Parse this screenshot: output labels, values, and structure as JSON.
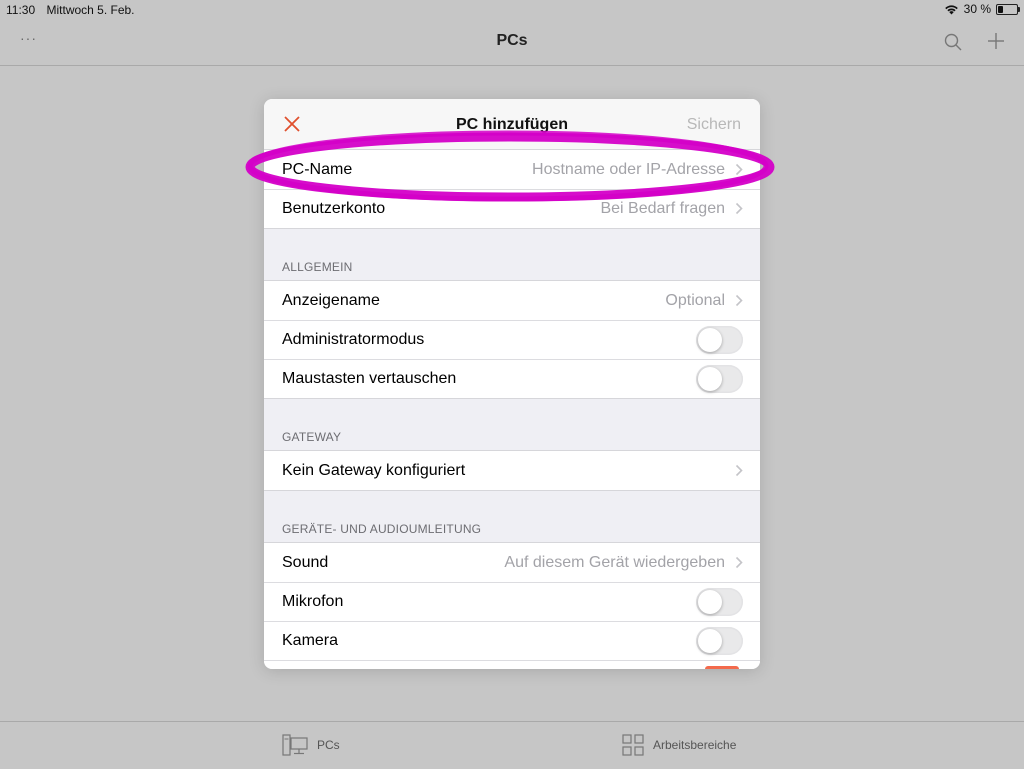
{
  "status_bar": {
    "time": "11:30",
    "date": "Mittwoch 5. Feb.",
    "battery": "30 %",
    "battery_level": 0.3
  },
  "nav": {
    "title": "PCs",
    "more": "···"
  },
  "modal": {
    "title": "PC hinzufügen",
    "save_label": "Sichern",
    "rows_top": [
      {
        "label": "PC-Name",
        "value": "Hostname oder IP-Adresse"
      },
      {
        "label": "Benutzerkonto",
        "value": "Bei Bedarf fragen"
      }
    ],
    "sections": {
      "general": {
        "header": "ALLGEMEIN",
        "display_name": {
          "label": "Anzeigename",
          "value": "Optional"
        },
        "admin_mode": {
          "label": "Administratormodus",
          "on": false
        },
        "swap_mouse": {
          "label": "Maustasten vertauschen",
          "on": false
        }
      },
      "gateway": {
        "header": "GATEWAY",
        "row": {
          "label": "Kein Gateway konfiguriert"
        }
      },
      "redirection": {
        "header": "GERÄTE- UND AUDIOUMLEITUNG",
        "sound": {
          "label": "Sound",
          "value": "Auf diesem Gerät wiedergeben"
        },
        "microphone": {
          "label": "Mikrofon",
          "on": false
        },
        "camera": {
          "label": "Kamera",
          "on": false
        }
      }
    }
  },
  "tabs": [
    {
      "label": "PCs"
    },
    {
      "label": "Arbeitsbereiche"
    }
  ],
  "colors": {
    "accent": "#e0502e",
    "annotation": "#d400c8"
  },
  "icons": [
    "wifi-icon",
    "battery-icon",
    "more-icon",
    "search-icon",
    "add-icon",
    "close-icon",
    "chevron-right-icon",
    "pc-monitor-icon",
    "workspaces-icon"
  ]
}
